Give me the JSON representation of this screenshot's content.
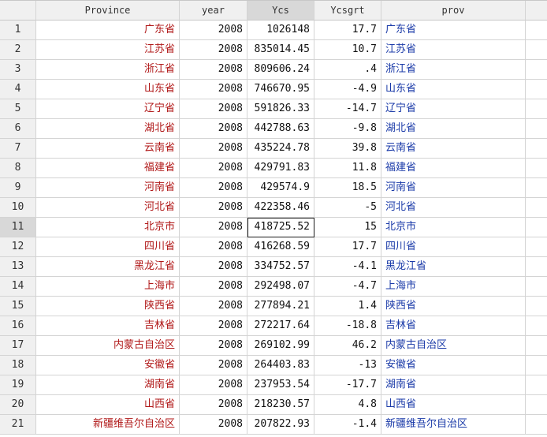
{
  "columns": [
    "Province",
    "year",
    "Ycs",
    "Ycsgrt",
    "prov"
  ],
  "active_column": "Ycs",
  "selected_row": 11,
  "rows": [
    {
      "n": "1",
      "province": "广东省",
      "year": "2008",
      "ycs": "1026148",
      "ycsgrt": "17.7",
      "prov": "广东省"
    },
    {
      "n": "2",
      "province": "江苏省",
      "year": "2008",
      "ycs": "835014.45",
      "ycsgrt": "10.7",
      "prov": "江苏省"
    },
    {
      "n": "3",
      "province": "浙江省",
      "year": "2008",
      "ycs": "809606.24",
      "ycsgrt": ".4",
      "prov": "浙江省"
    },
    {
      "n": "4",
      "province": "山东省",
      "year": "2008",
      "ycs": "746670.95",
      "ycsgrt": "-4.9",
      "prov": "山东省"
    },
    {
      "n": "5",
      "province": "辽宁省",
      "year": "2008",
      "ycs": "591826.33",
      "ycsgrt": "-14.7",
      "prov": "辽宁省"
    },
    {
      "n": "6",
      "province": "湖北省",
      "year": "2008",
      "ycs": "442788.63",
      "ycsgrt": "-9.8",
      "prov": "湖北省"
    },
    {
      "n": "7",
      "province": "云南省",
      "year": "2008",
      "ycs": "435224.78",
      "ycsgrt": "39.8",
      "prov": "云南省"
    },
    {
      "n": "8",
      "province": "福建省",
      "year": "2008",
      "ycs": "429791.83",
      "ycsgrt": "11.8",
      "prov": "福建省"
    },
    {
      "n": "9",
      "province": "河南省",
      "year": "2008",
      "ycs": "429574.9",
      "ycsgrt": "18.5",
      "prov": "河南省"
    },
    {
      "n": "10",
      "province": "河北省",
      "year": "2008",
      "ycs": "422358.46",
      "ycsgrt": "-5",
      "prov": "河北省"
    },
    {
      "n": "11",
      "province": "北京市",
      "year": "2008",
      "ycs": "418725.52",
      "ycsgrt": "15",
      "prov": "北京市"
    },
    {
      "n": "12",
      "province": "四川省",
      "year": "2008",
      "ycs": "416268.59",
      "ycsgrt": "17.7",
      "prov": "四川省"
    },
    {
      "n": "13",
      "province": "黑龙江省",
      "year": "2008",
      "ycs": "334752.57",
      "ycsgrt": "-4.1",
      "prov": "黑龙江省"
    },
    {
      "n": "14",
      "province": "上海市",
      "year": "2008",
      "ycs": "292498.07",
      "ycsgrt": "-4.7",
      "prov": "上海市"
    },
    {
      "n": "15",
      "province": "陕西省",
      "year": "2008",
      "ycs": "277894.21",
      "ycsgrt": "1.4",
      "prov": "陕西省"
    },
    {
      "n": "16",
      "province": "吉林省",
      "year": "2008",
      "ycs": "272217.64",
      "ycsgrt": "-18.8",
      "prov": "吉林省"
    },
    {
      "n": "17",
      "province": "内蒙古自治区",
      "year": "2008",
      "ycs": "269102.99",
      "ycsgrt": "46.2",
      "prov": "内蒙古自治区"
    },
    {
      "n": "18",
      "province": "安徽省",
      "year": "2008",
      "ycs": "264403.83",
      "ycsgrt": "-13",
      "prov": "安徽省"
    },
    {
      "n": "19",
      "province": "湖南省",
      "year": "2008",
      "ycs": "237953.54",
      "ycsgrt": "-17.7",
      "prov": "湖南省"
    },
    {
      "n": "20",
      "province": "山西省",
      "year": "2008",
      "ycs": "218230.57",
      "ycsgrt": "4.8",
      "prov": "山西省"
    },
    {
      "n": "21",
      "province": "新疆维吾尔自治区",
      "year": "2008",
      "ycs": "207822.93",
      "ycsgrt": "-1.4",
      "prov": "新疆维吾尔自治区"
    }
  ],
  "colors": {
    "province_text": "#b01717",
    "prov_text": "#1a3aa8",
    "grid_line": "#d4d4d4",
    "header_bg": "#f0f0f0"
  }
}
